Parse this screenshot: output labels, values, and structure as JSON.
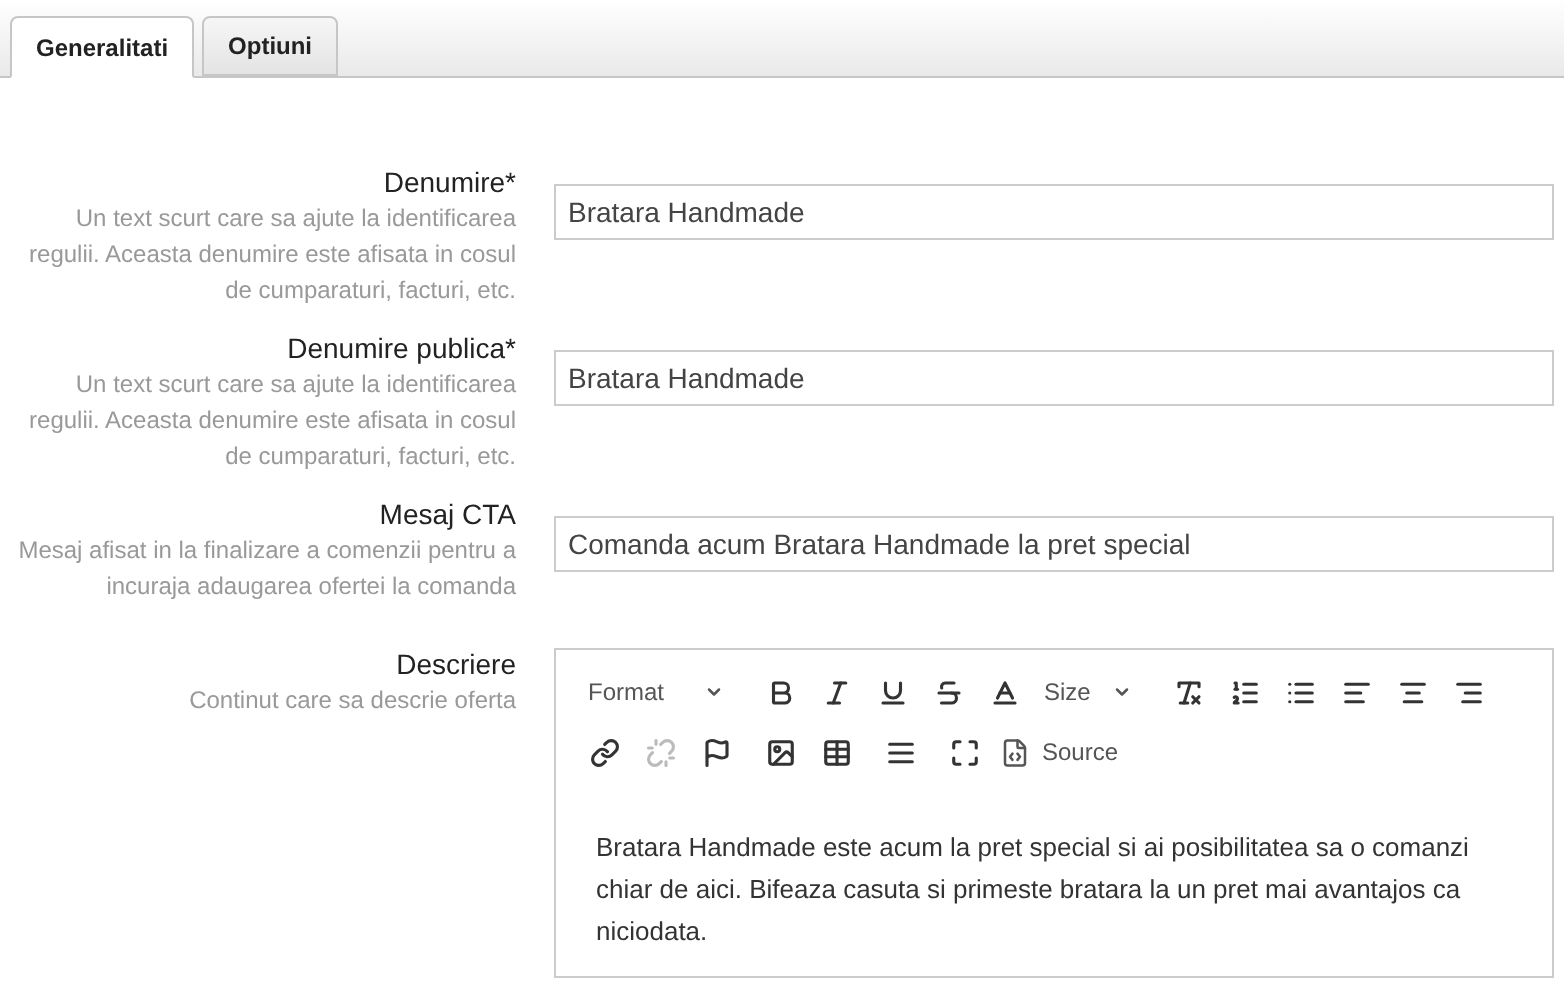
{
  "tabs": [
    {
      "label": "Generalitati",
      "selected": true
    },
    {
      "label": "Optiuni",
      "selected": false
    }
  ],
  "fields": [
    {
      "kind": "input",
      "label": "Denumire*",
      "help": "Un text scurt care sa ajute la identificarea regulii. Aceasta denumire este afisata in cosul de cumparaturi, facturi, etc.",
      "value": "Bratara Handmade"
    },
    {
      "kind": "input",
      "label": "Denumire publica*",
      "help": "Un text scurt care sa ajute la identificarea regulii. Aceasta denumire este afisata in cosul de cumparaturi, facturi, etc.",
      "value": "Bratara Handmade"
    },
    {
      "kind": "input",
      "label": "Mesaj CTA",
      "help": "Mesaj afisat in la finalizare a comenzii pentru a incuraja adaugarea ofertei la comanda",
      "value": "Comanda acum Bratara Handmade la pret special"
    },
    {
      "kind": "editor",
      "label": "Descriere",
      "help": "Continut care sa descrie oferta",
      "value": "Bratara Handmade este acum la pret special si ai posibilitatea sa o comanzi chiar de aici. Bifeaza casuta si primeste bratara la un pret mai avantajos ca niciodata."
    }
  ],
  "toolbar": [
    [
      {
        "kind": "dropdown",
        "label": "Format"
      },
      {
        "kind": "bold",
        "disabled": false
      },
      {
        "kind": "italic",
        "disabled": false
      },
      {
        "kind": "underline",
        "disabled": false
      },
      {
        "kind": "strike",
        "disabled": false
      },
      {
        "kind": "color",
        "disabled": false
      },
      {
        "kind": "dropdown",
        "label": "Size"
      },
      {
        "kind": "clear",
        "disabled": false
      },
      {
        "kind": "numbered",
        "disabled": false
      },
      {
        "kind": "bulleted",
        "disabled": false
      },
      {
        "kind": "left",
        "disabled": false
      },
      {
        "kind": "center",
        "disabled": false
      },
      {
        "kind": "right",
        "disabled": false
      }
    ],
    [
      {
        "kind": "link",
        "disabled": false
      },
      {
        "kind": "unlink",
        "disabled": true
      },
      {
        "kind": "anchor",
        "disabled": false
      },
      {
        "kind": "image",
        "disabled": false
      },
      {
        "kind": "table",
        "disabled": false
      },
      {
        "kind": "rule",
        "disabled": false
      },
      {
        "kind": "maximize",
        "disabled": false
      },
      {
        "kind": "source",
        "label": "Source"
      }
    ]
  ]
}
